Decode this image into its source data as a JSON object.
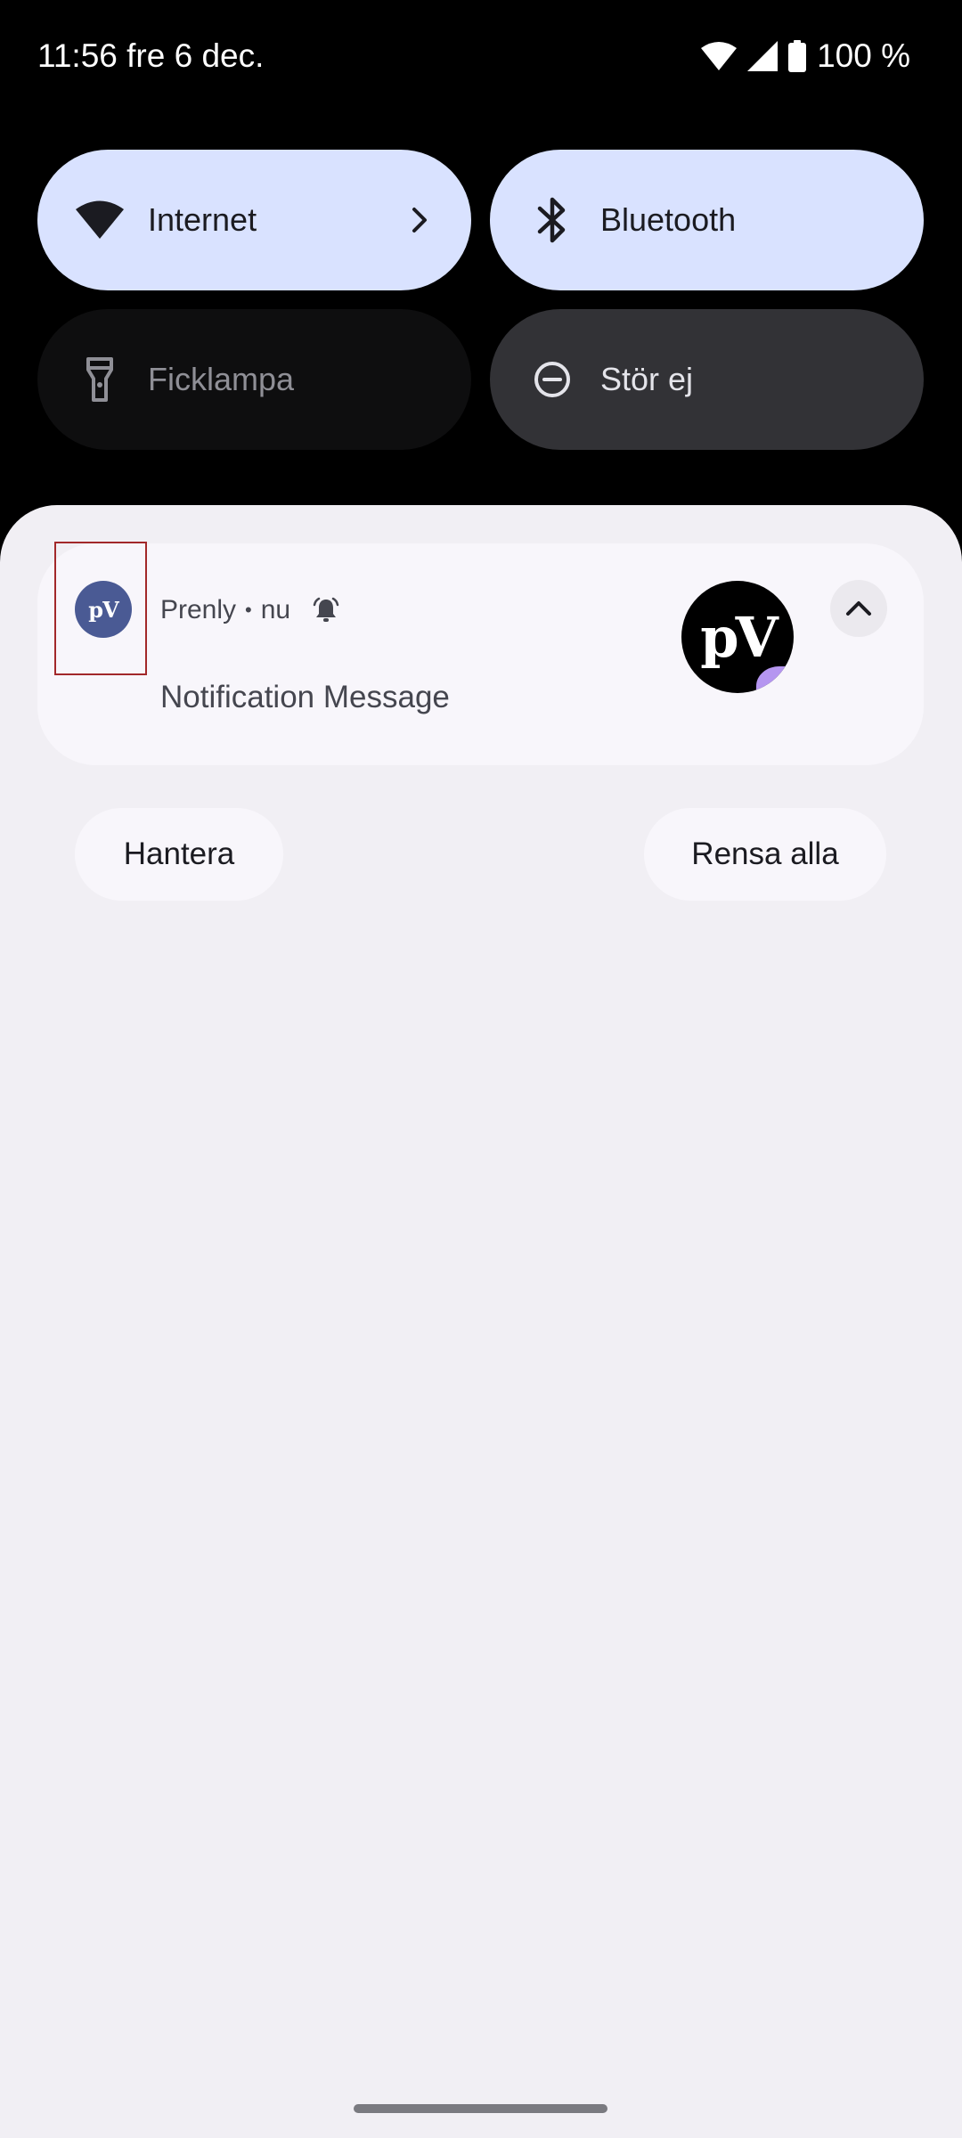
{
  "status_bar": {
    "clock": "11:56 fre 6 dec.",
    "battery_text": "100 %",
    "icons": [
      "wifi-icon",
      "cell-signal-icon",
      "battery-icon"
    ]
  },
  "quick_settings": {
    "tiles": [
      {
        "label": "Internet",
        "icon": "wifi-icon",
        "state": "on",
        "has_chevron": true
      },
      {
        "label": "Bluetooth",
        "icon": "bluetooth-icon",
        "state": "on"
      },
      {
        "label": "Ficklampa",
        "icon": "flashlight-icon",
        "state": "off"
      },
      {
        "label": "Stör ej",
        "icon": "do-not-disturb-icon",
        "state": "off"
      }
    ]
  },
  "notification": {
    "app_name": "Prenly",
    "separator": "•",
    "time": "nu",
    "app_icon_text": "pV",
    "large_icon_text": "pV",
    "message": "Notification Message",
    "icons": [
      "app-icon",
      "alert-bell-icon",
      "expand-collapse-icon"
    ]
  },
  "footer": {
    "manage_label": "Hantera",
    "clear_all_label": "Rensa alla"
  },
  "colors": {
    "tile_on": "#d9e2ff",
    "tile_off": "#0e0e0f",
    "tile_dnd": "#323236",
    "shade_bg": "#f1eff4",
    "card_bg": "#f8f6fb",
    "app_icon_bg": "#4a5a94",
    "highlight_border": "#a2282a"
  }
}
